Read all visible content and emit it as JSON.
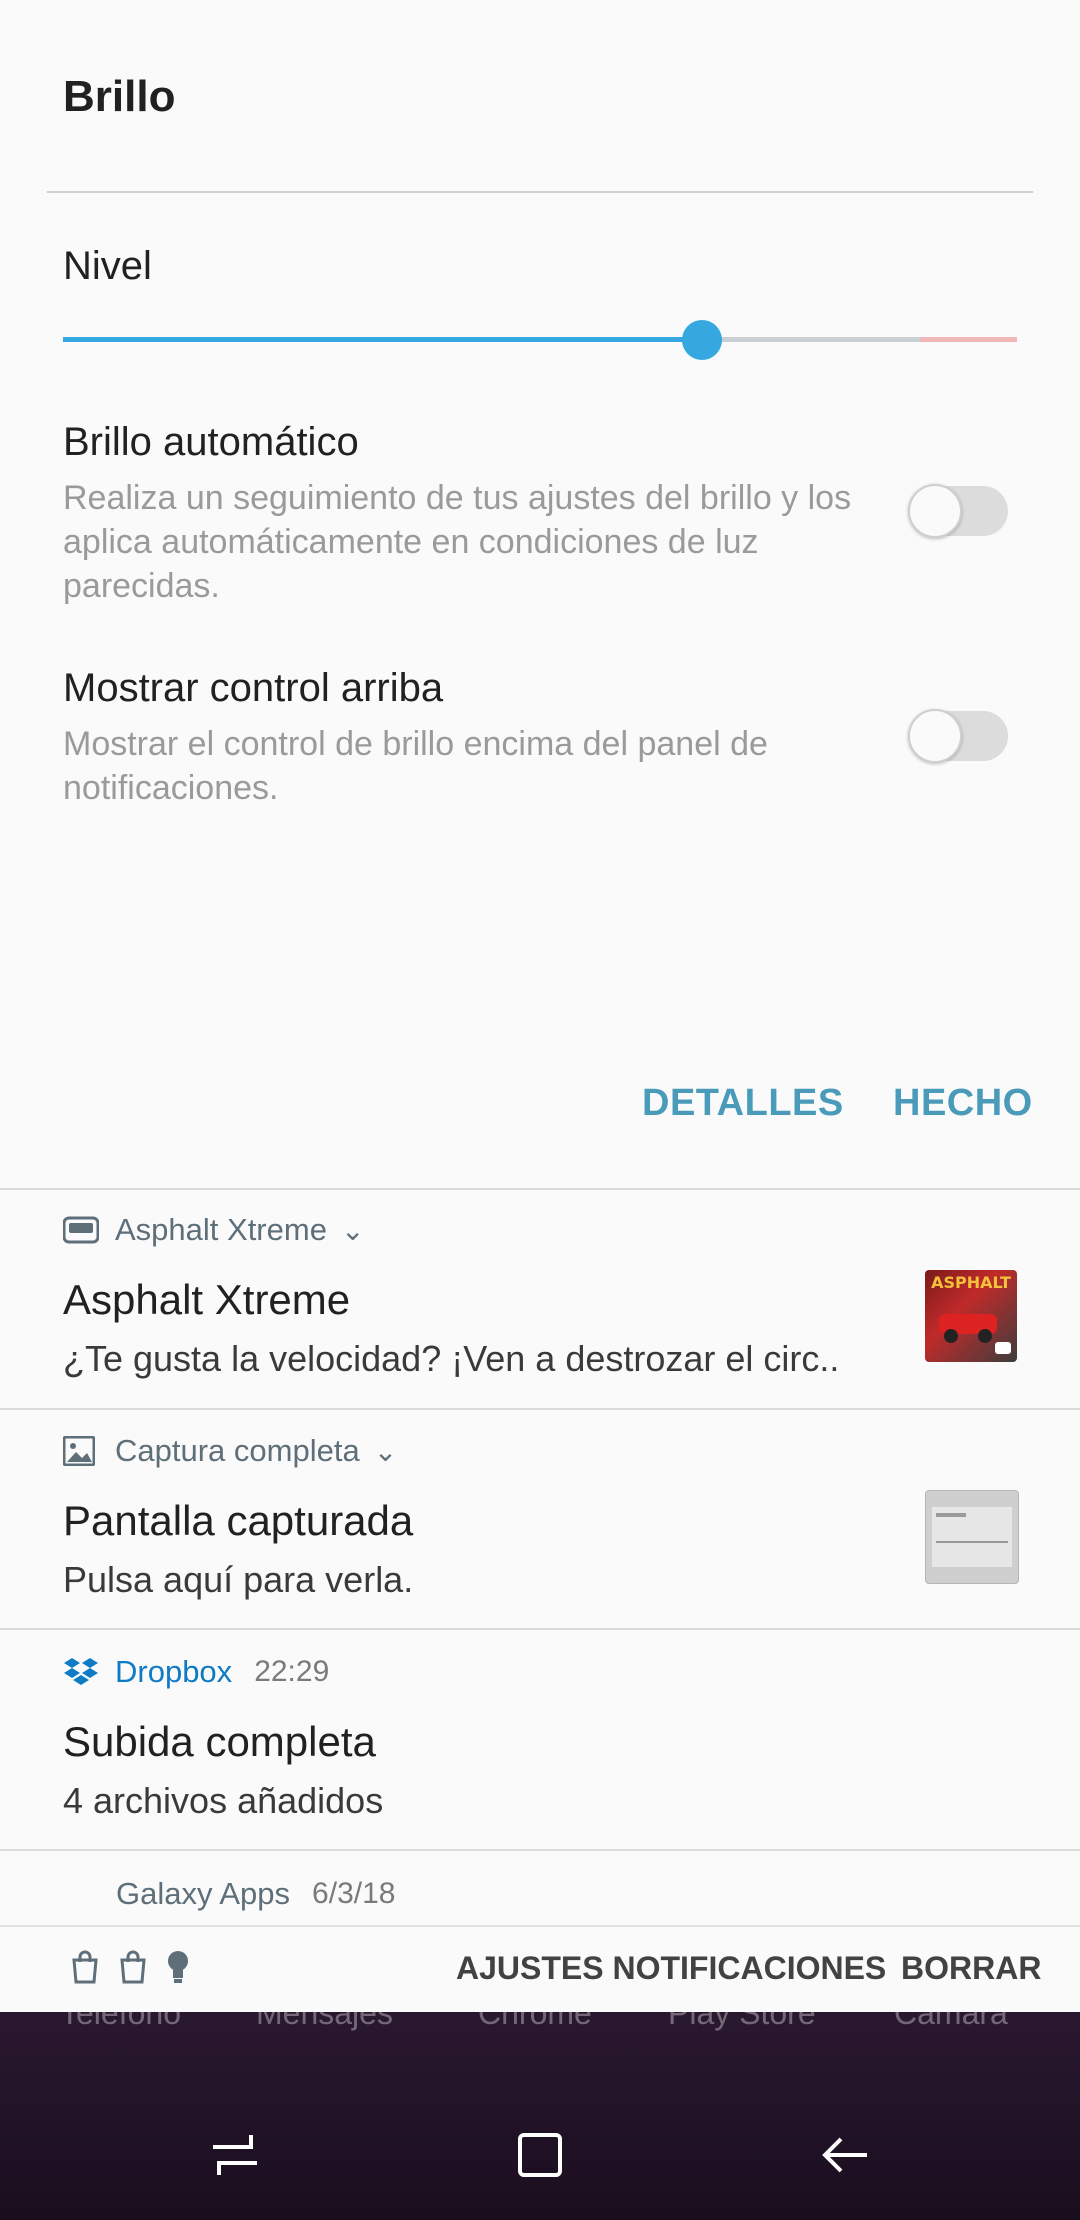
{
  "panel": {
    "title": "Brillo",
    "level_label": "Nivel",
    "brightness_level_percent": 67,
    "auto_brightness": {
      "title": "Brillo automático",
      "description": "Realiza un seguimiento de tus ajustes del brillo y los aplica automáticamente en condiciones de luz parecidas.",
      "enabled": false
    },
    "show_control_top": {
      "title": "Mostrar control arriba",
      "description": "Mostrar el control de brillo encima del panel de notificaciones.",
      "enabled": false
    },
    "buttons": {
      "details": "DETALLES",
      "done": "HECHO"
    }
  },
  "notifications": [
    {
      "app": "Asphalt Xtreme",
      "icon": "gamepad-icon",
      "title": "Asphalt Xtreme",
      "body": "¿Te gusta la velocidad? ¡Ven a destrozar el circ..",
      "has_thumbnail": true
    },
    {
      "app": "Captura completa",
      "icon": "image-icon",
      "title": "Pantalla capturada",
      "body": "Pulsa aquí para verla.",
      "has_thumbnail": true
    },
    {
      "app": "Dropbox",
      "icon": "dropbox-icon",
      "time": "22:29",
      "title": "Subida completa",
      "body": "4 archivos añadidos"
    },
    {
      "app": "Galaxy Apps",
      "time": "6/3/18"
    }
  ],
  "bottom_bar": {
    "notification_settings": "AJUSTES NOTIFICACIONES",
    "clear": "BORRAR",
    "icons": [
      "shopping-bag-icon",
      "shopping-bag-icon",
      "lightbulb-icon"
    ]
  },
  "dock": {
    "apps": [
      "Teléfono",
      "Mensajes",
      "Chrome",
      "Play Store",
      "Cámara"
    ]
  },
  "navigation": [
    "recents-icon",
    "home-icon",
    "back-icon"
  ],
  "colors": {
    "accent": "#35a8e0",
    "button_text": "#4a9bb9",
    "dropbox": "#0f7bc4"
  }
}
